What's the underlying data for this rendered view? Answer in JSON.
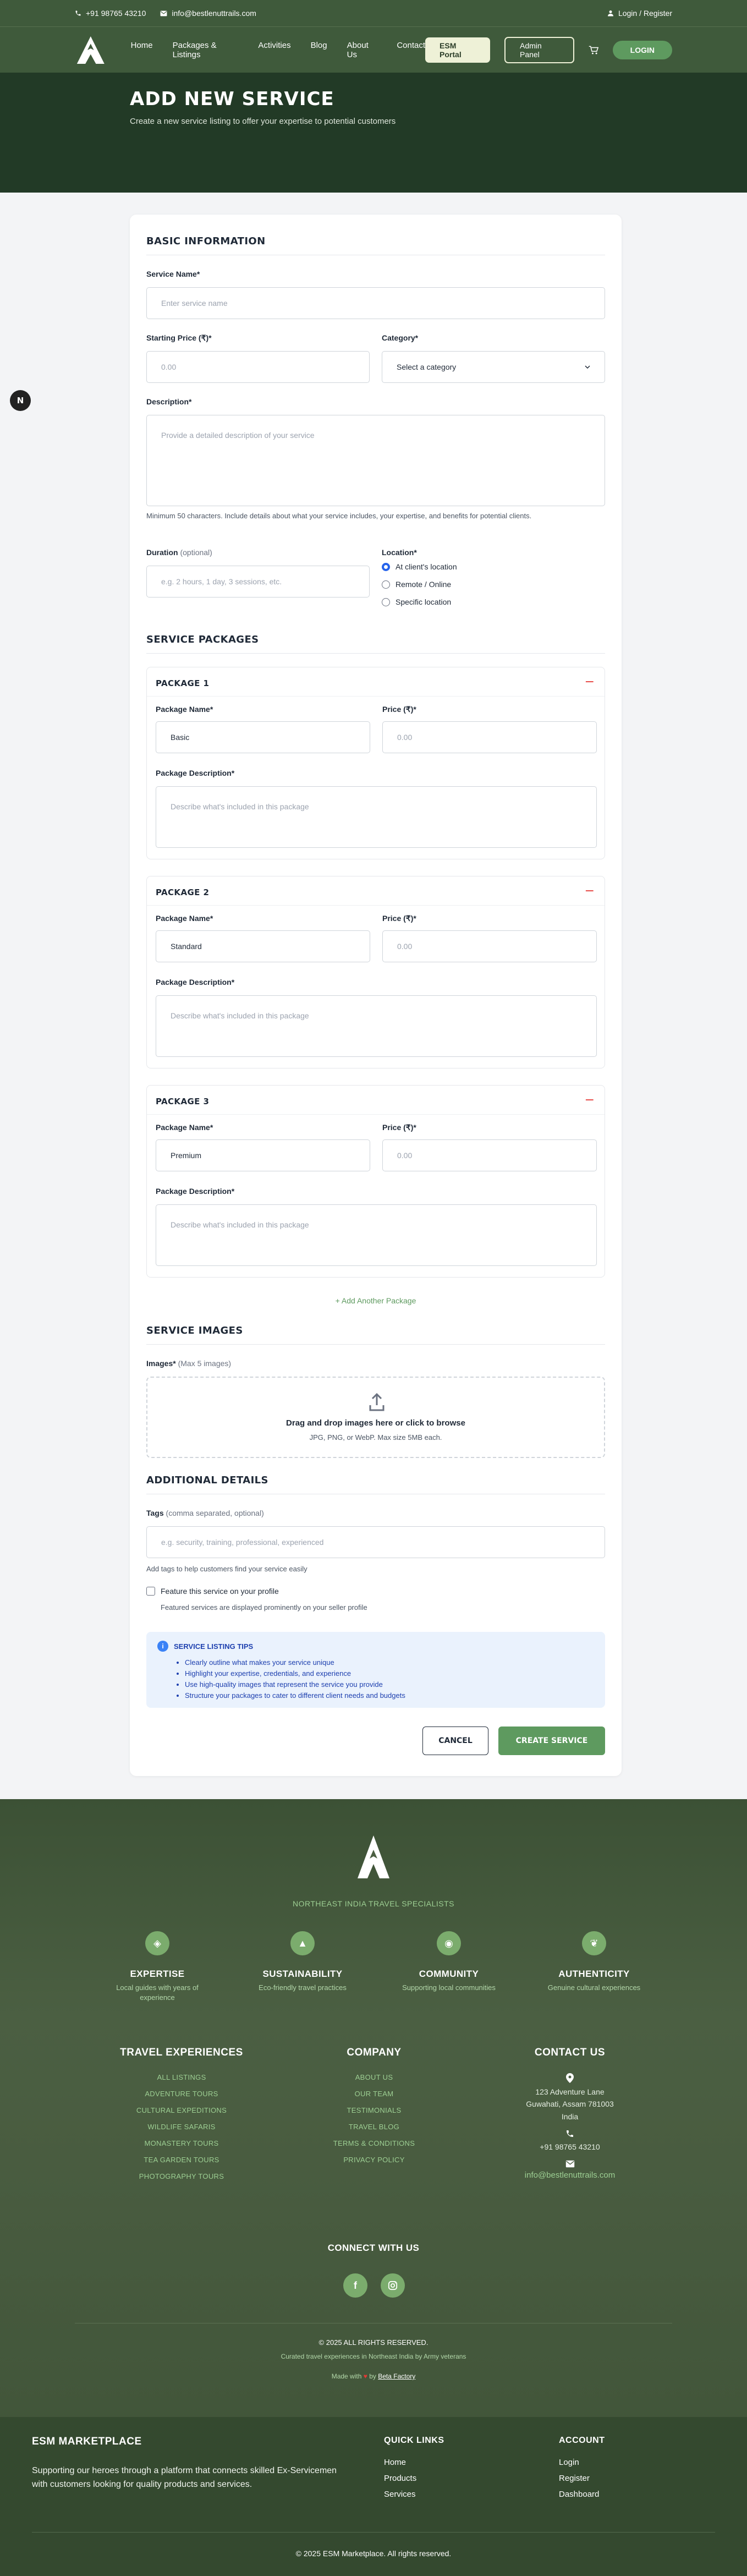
{
  "topbar": {
    "phone": "+91 98765 43210",
    "email": "info@bestlenuttrails.com",
    "login_register": "Login / Register"
  },
  "nav": {
    "items": [
      "Home",
      "Packages & Listings",
      "Activities",
      "Blog",
      "About Us",
      "Contact"
    ],
    "esm_portal": "ESM Portal",
    "admin_panel": "Admin Panel",
    "login": "LOGIN"
  },
  "hero": {
    "title": "ADD NEW SERVICE",
    "subtitle": "Create a new service listing to offer your expertise to potential customers"
  },
  "fab_label": "N",
  "form": {
    "basic": {
      "title": "BASIC INFORMATION",
      "service_name_label": "Service Name*",
      "service_name_placeholder": "Enter service name",
      "price_label": "Starting Price (₹)*",
      "price_placeholder": "0.00",
      "category_label": "Category*",
      "category_value": "Select a category",
      "description_label": "Description*",
      "description_placeholder": "Provide a detailed description of your service",
      "description_hint": "Minimum 50 characters. Include details about what your service includes, your expertise, and benefits for potential clients.",
      "duration_label": "Duration",
      "duration_optional": "(optional)",
      "duration_placeholder": "e.g. 2 hours, 1 day, 3 sessions, etc.",
      "location_label": "Location*",
      "location_options": [
        "At client's location",
        "Remote / Online",
        "Specific location"
      ]
    },
    "packages": {
      "title": "SERVICE PACKAGES",
      "name_label": "Package Name*",
      "price_label": "Price (₹)*",
      "price_placeholder": "0.00",
      "desc_label": "Package Description*",
      "desc_placeholder": "Describe what's included in this package",
      "remove_symbol": "−",
      "items": [
        {
          "title": "PACKAGE 1",
          "name": "Basic"
        },
        {
          "title": "PACKAGE 2",
          "name": "Standard"
        },
        {
          "title": "PACKAGE 3",
          "name": "Premium"
        }
      ],
      "add_label": "+ Add Another Package"
    },
    "images": {
      "title": "SERVICE IMAGES",
      "label": "Images*",
      "label_note": "(Max 5 images)",
      "drop_title": "Drag and drop images here or click to browse",
      "drop_hint": "JPG, PNG, or WebP. Max size 5MB each."
    },
    "additional": {
      "title": "ADDITIONAL DETAILS",
      "tags_label": "Tags",
      "tags_note": "(comma separated, optional)",
      "tags_placeholder": "e.g. security, training, professional, experienced",
      "tags_hint": "Add tags to help customers find your service easily",
      "feature_label": "Feature this service on your profile",
      "feature_hint": "Featured services are displayed prominently on your seller profile"
    },
    "tips": {
      "title": "SERVICE LISTING TIPS",
      "items": [
        "Clearly outline what makes your service unique",
        "Highlight your expertise, credentials, and experience",
        "Use high-quality images that represent the service you provide",
        "Structure your packages to cater to different client needs and budgets"
      ]
    },
    "cancel": "CANCEL",
    "create": "CREATE SERVICE"
  },
  "footer": {
    "tagline": "NORTHEAST INDIA TRAVEL SPECIALISTS",
    "features": [
      {
        "title": "EXPERTISE",
        "desc": "Local guides with years of experience"
      },
      {
        "title": "SUSTAINABILITY",
        "desc": "Eco-friendly travel practices"
      },
      {
        "title": "COMMUNITY",
        "desc": "Supporting local communities"
      },
      {
        "title": "AUTHENTICITY",
        "desc": "Genuine cultural experiences"
      }
    ],
    "travel_title": "TRAVEL EXPERIENCES",
    "travel_links": [
      "ALL LISTINGS",
      "ADVENTURE TOURS",
      "CULTURAL EXPEDITIONS",
      "WILDLIFE SAFARIS",
      "MONASTERY TOURS",
      "TEA GARDEN TOURS",
      "PHOTOGRAPHY TOURS"
    ],
    "company_title": "COMPANY",
    "company_links": [
      "ABOUT US",
      "OUR TEAM",
      "TESTIMONIALS",
      "TRAVEL BLOG",
      "TERMS & CONDITIONS",
      "PRIVACY POLICY"
    ],
    "contact_title": "CONTACT US",
    "address_line1": "123 Adventure Lane",
    "address_line2": "Guwahati, Assam 781003",
    "address_line3": "India",
    "phone": "+91 98765 43210",
    "email": "info@bestlenuttrails.com",
    "connect": "CONNECT WITH US",
    "copyright": "© 2025 ALL RIGHTS RESERVED.",
    "curated": "Curated travel experiences in Northeast India by Army veterans",
    "made_prefix": "Made with",
    "made_by": "by",
    "made_name": "Beta Factory"
  },
  "marketplace": {
    "title": "ESM MARKETPLACE",
    "description": "Supporting our heroes through a platform that connects skilled Ex-Servicemen with customers looking for quality products and services.",
    "quick_title": "QUICK LINKS",
    "quick_links": [
      "Home",
      "Products",
      "Services"
    ],
    "account_title": "ACCOUNT",
    "account_links": [
      "Login",
      "Register",
      "Dashboard"
    ],
    "copyright": "© 2025 ESM Marketplace. All rights reserved."
  }
}
